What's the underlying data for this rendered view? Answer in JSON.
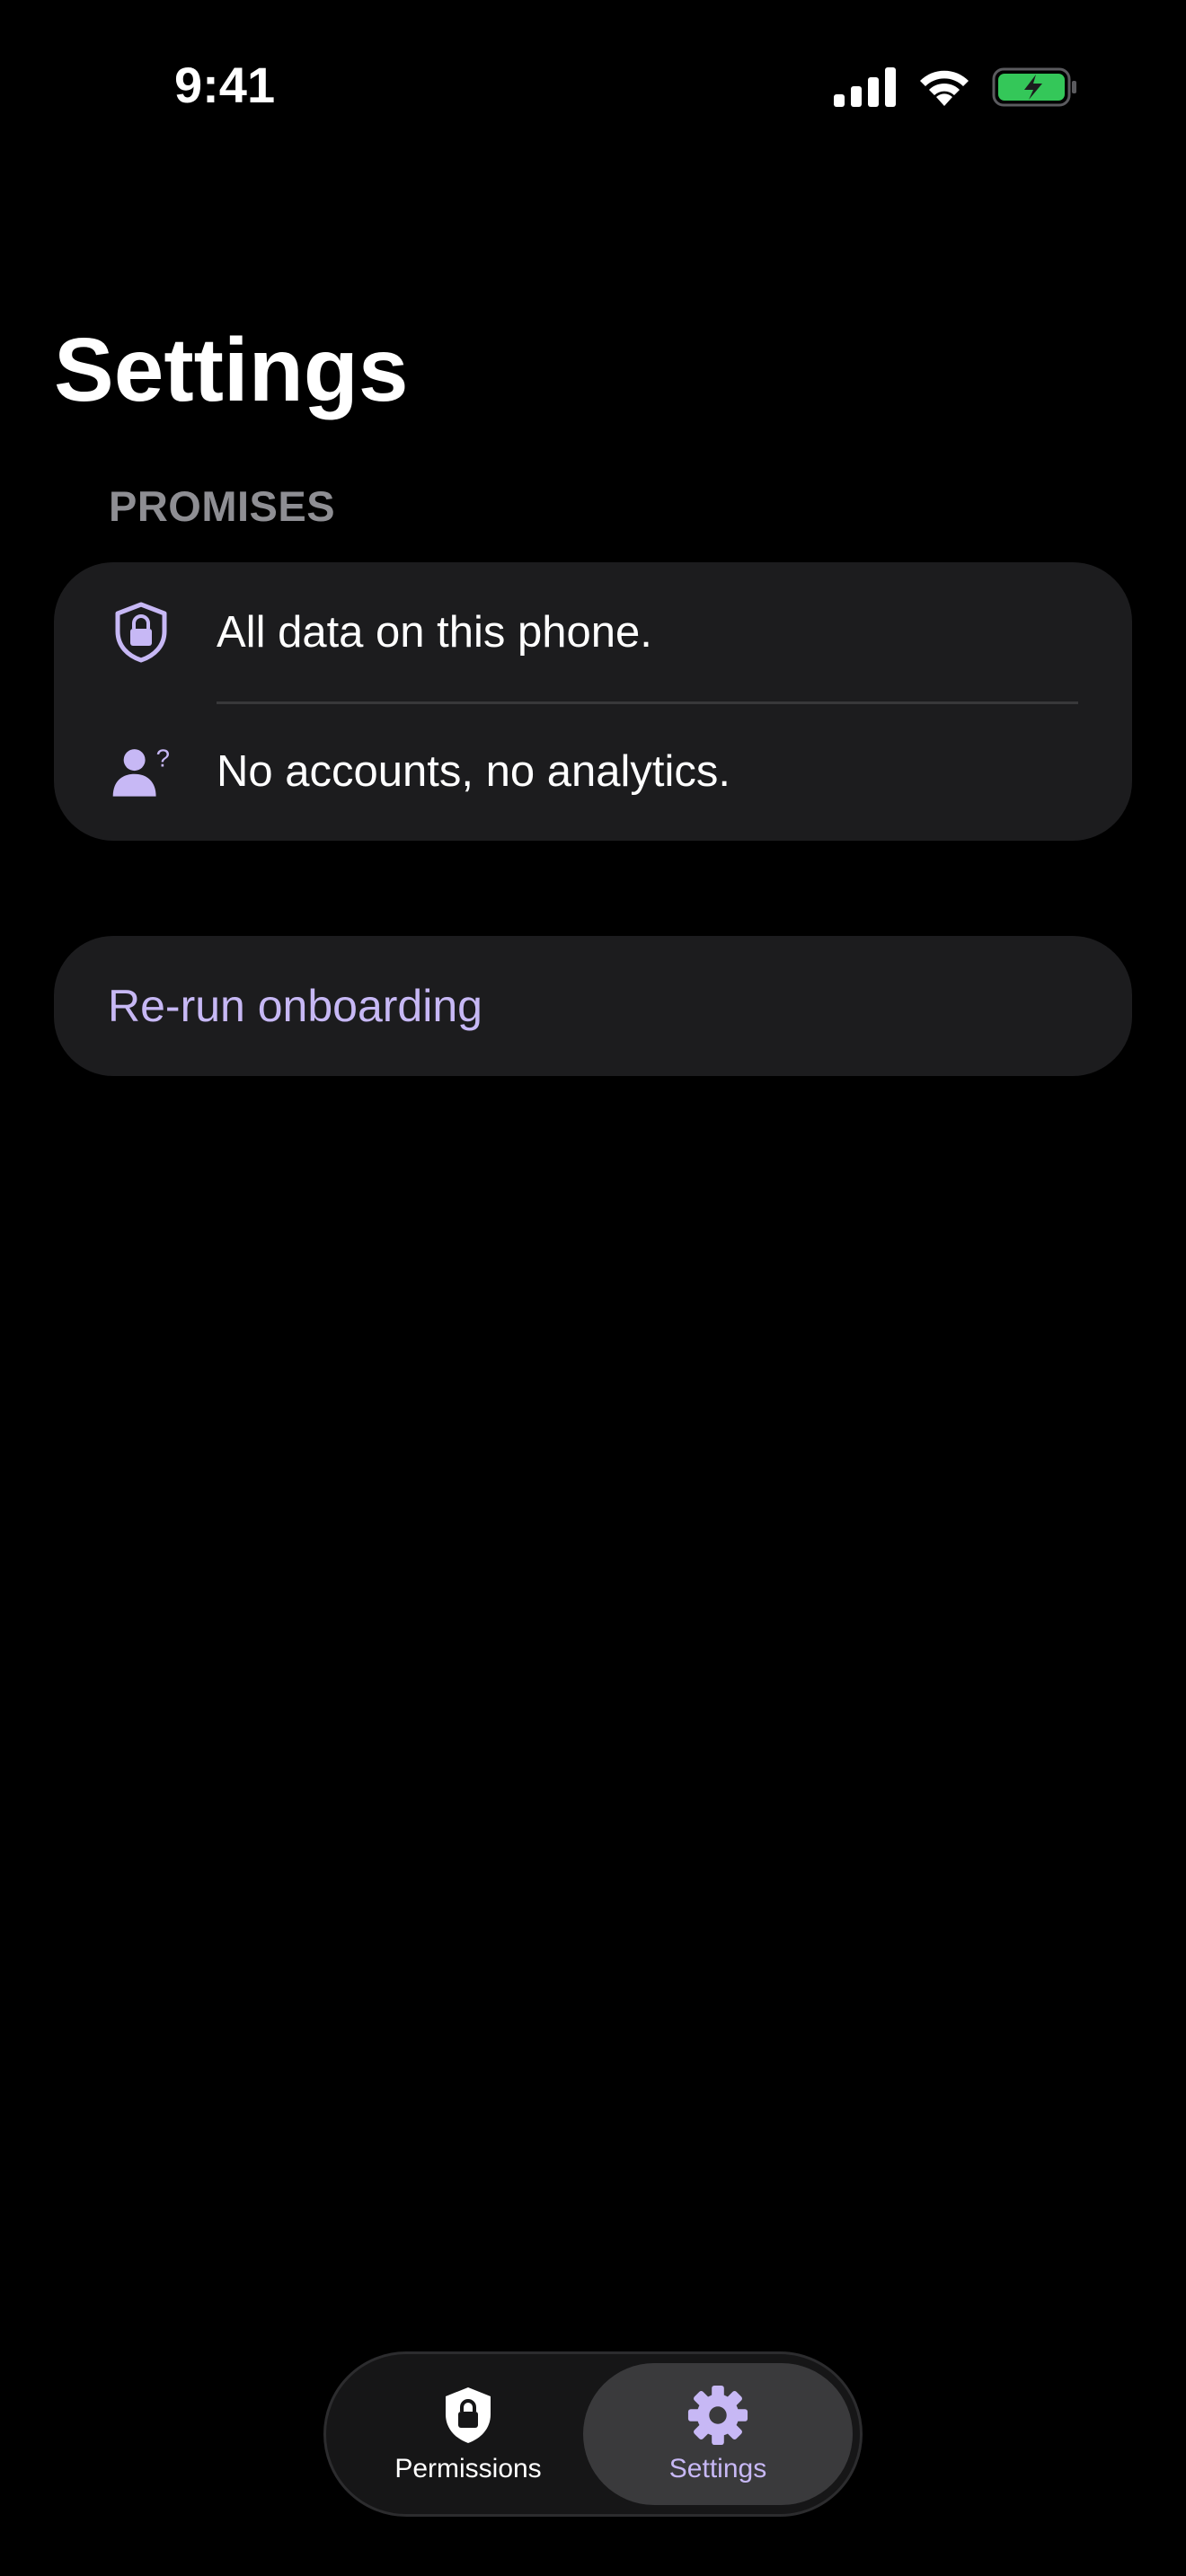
{
  "status_bar": {
    "time": "9:41",
    "icons": [
      "cellular-signal-icon",
      "wifi-icon",
      "battery-charging-icon"
    ]
  },
  "header": {
    "title": "Settings"
  },
  "promises": {
    "section_title": "PROMISES",
    "items": [
      {
        "icon": "shield-lock-icon",
        "label": "All data on this phone."
      },
      {
        "icon": "person-question-icon",
        "label": "No accounts, no analytics."
      }
    ]
  },
  "actions": {
    "rerun_onboarding_label": "Re-run onboarding"
  },
  "tab_bar": {
    "tabs": [
      {
        "icon": "shield-lock-icon",
        "label": "Permissions",
        "selected": false
      },
      {
        "icon": "gear-icon",
        "label": "Settings",
        "selected": true
      }
    ]
  },
  "colors": {
    "background": "#000000",
    "card": "#1c1c1e",
    "accent": "#c7b8f5",
    "secondary_text": "#8e8e93",
    "battery": "#34c759"
  }
}
